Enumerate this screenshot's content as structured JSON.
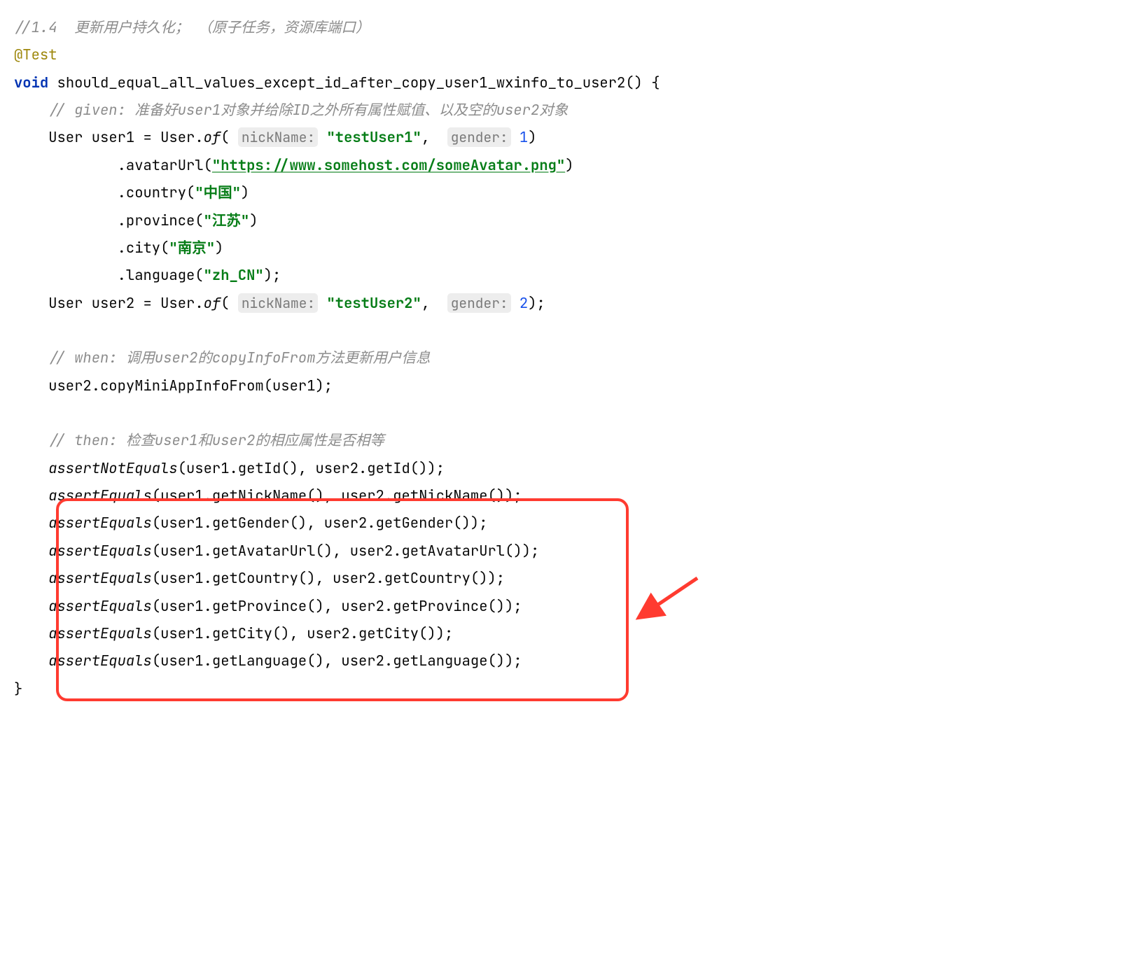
{
  "comments": {
    "top": "//1.4  更新用户持久化； （原子任务，资源库端口）",
    "given": "// given: 准备好user1对象并给除ID之外所有属性赋值、以及空的user2对象",
    "when": "// when: 调用user2的copyInfoFrom方法更新用户信息",
    "then": "// then: 检查user1和user2的相应属性是否相等"
  },
  "annotation": "@Test",
  "keyword_void": "void",
  "method_name": "should_equal_all_values_except_id_after_copy_user1_wxinfo_to_user2",
  "hints": {
    "nickName": "nickName:",
    "gender": "gender:"
  },
  "strings": {
    "testUser1": "\"testUser1\"",
    "testUser2": "\"testUser2\"",
    "avatarUrl": "\"https://www.somehost.com/someAvatar.png\"",
    "country": "\"中国\"",
    "province": "\"江苏\"",
    "city": "\"南京\"",
    "language": "\"zh_CN\""
  },
  "numbers": {
    "one": "1",
    "two": "2"
  },
  "builder": {
    "of": "of",
    "avatarUrl": ".avatarUrl(",
    "country": ".country(",
    "province": ".province(",
    "city": ".city(",
    "language": ".language("
  },
  "tokens": {
    "User": "User",
    "user1": "user1",
    "user2": "user2",
    "eq": " = ",
    "dot": "."
  },
  "stmt_copy": "user2.copyMiniAppInfoFrom(user1);",
  "asserts": {
    "notEq": "assertNotEquals",
    "eq": "assertEquals",
    "line_id": "(user1.getId(), user2.getId());",
    "line_nick": "(user1.getNickName(), user2.getNickName());",
    "line_gender": "(user1.getGender(), user2.getGender());",
    "line_avatar": "(user1.getAvatarUrl(), user2.getAvatarUrl());",
    "line_country": "(user1.getCountry(), user2.getCountry());",
    "line_province": "(user1.getProvince(), user2.getProvince());",
    "line_city": "(user1.getCity(), user2.getCity());",
    "line_language": "(user1.getLanguage(), user2.getLanguage());"
  },
  "braces": {
    "open": "() {",
    "close": "}",
    "paren_close": ")",
    "paren_close_semi": ");"
  }
}
